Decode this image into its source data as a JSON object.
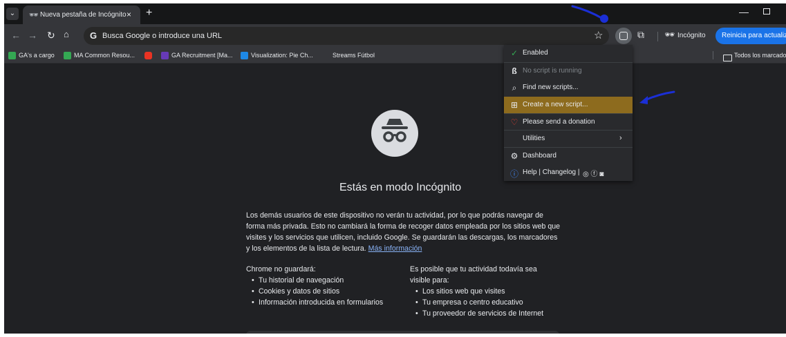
{
  "tab": {
    "title": "Nueva pestaña de Incógnito",
    "close": "×",
    "new_tab": "+"
  },
  "toolbar": {
    "omnibox_placeholder": "Busca Google o introduce una URL",
    "google_glyph": "G",
    "incognito_label": "Incógnito",
    "relaunch_label": "Reinicia para actualizar"
  },
  "bookmarks": [
    {
      "label": "GA's a cargo",
      "color": "#34a853"
    },
    {
      "label": "MA Common Resou...",
      "color": "#34a853"
    },
    {
      "label": "",
      "color": "#ea3323"
    },
    {
      "label": "GA Recruitment [Ma...",
      "color": "#673ab7"
    },
    {
      "label": "Visualization: Pie Ch...",
      "color": "#34a853"
    },
    {
      "label": "Streams Fútbol",
      "color": ""
    }
  ],
  "bookmarks_folder": "Todos los marcadores",
  "extension_menu": {
    "enabled": "Enabled",
    "no_script": "No script is running",
    "find": "Find new scripts...",
    "create": "Create a new script...",
    "donate": "Please send a donation",
    "utilities": "Utilities",
    "dashboard": "Dashboard",
    "help": "Help | Changelog |"
  },
  "page": {
    "title": "Estás en modo Incógnito",
    "paragraph": "Los demás usuarios de este dispositivo no verán tu actividad, por lo que podrás navegar de forma más privada. Esto no cambiará la forma de recoger datos empleada por los sitios web que visites y los servicios que utilicen, incluido Google. Se guardarán las descargas, los marcadores y los elementos de la lista de lectura.",
    "learn_more": "Más información",
    "left_heading": "Chrome no guardará:",
    "left_items": [
      "Tu historial de navegación",
      "Cookies y datos de sitios",
      "Información introducida en formularios"
    ],
    "right_heading": "Es posible que tu actividad todavía sea visible para:",
    "right_items": [
      "Los sitios web que visites",
      "Tu empresa o centro educativo",
      "Tu proveedor de servicios de Internet"
    ]
  }
}
